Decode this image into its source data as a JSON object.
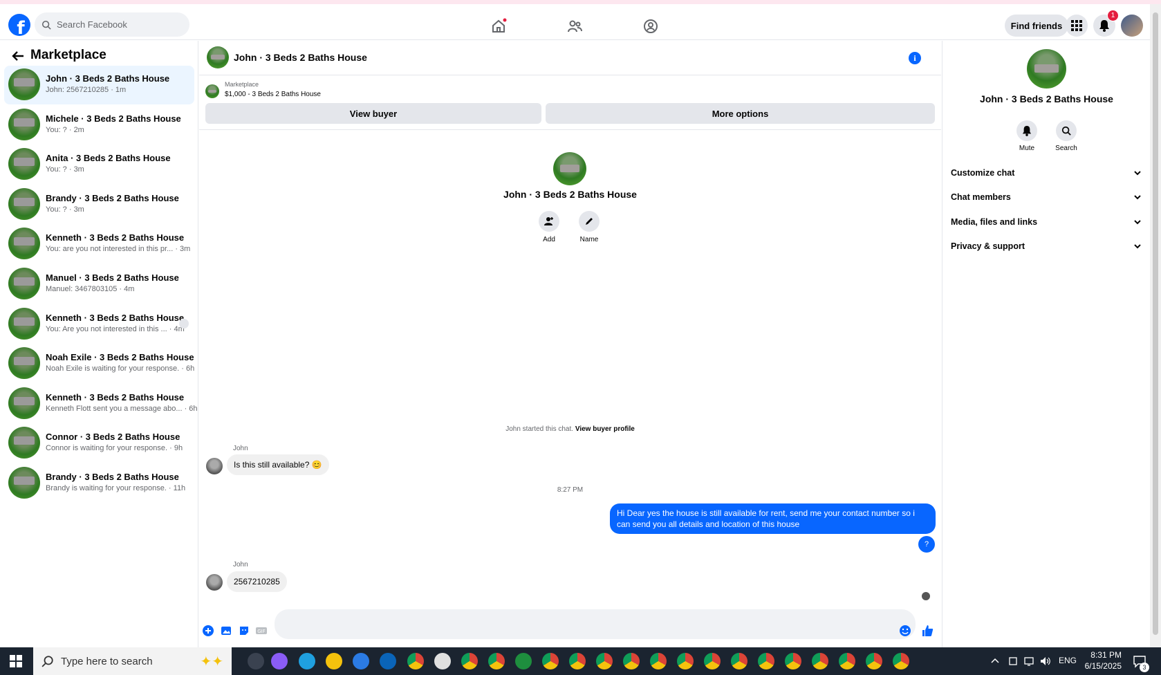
{
  "header": {
    "search_placeholder": "Search Facebook",
    "find_friends": "Find friends",
    "notification_count": "1"
  },
  "sidebar": {
    "title": "Marketplace",
    "conversations": [
      {
        "name": "John · 3 Beds 2 Baths House",
        "preview": "John: 2567210285 · 1m",
        "active": true
      },
      {
        "name": "Michele · 3 Beds 2 Baths House",
        "preview": "You: ? · 2m"
      },
      {
        "name": "Anita · 3 Beds 2 Baths House",
        "preview": "You: ? · 3m"
      },
      {
        "name": "Brandy · 3 Beds 2 Baths House",
        "preview": "You: ? · 3m"
      },
      {
        "name": "Kenneth · 3 Beds 2 Baths House",
        "preview": "You: are you not interested in this pr... · 3m"
      },
      {
        "name": "Manuel · 3 Beds 2 Baths House",
        "preview": "Manuel: 3467803105 · 4m"
      },
      {
        "name": "Kenneth · 3 Beds 2 Baths House",
        "preview": "You: Are you not interested in this ... · 4m"
      },
      {
        "name": "Noah Exile · 3 Beds 2 Baths House",
        "preview": "Noah Exile is waiting for your response. · 6h"
      },
      {
        "name": "Kenneth · 3 Beds 2 Baths House",
        "preview": "Kenneth Flott sent you a message abo... · 6h"
      },
      {
        "name": "Connor · 3 Beds 2 Baths House",
        "preview": "Connor is waiting for your response. · 9h"
      },
      {
        "name": "Brandy · 3 Beds 2 Baths House",
        "preview": "Brandy is waiting for your response. · 11h"
      }
    ]
  },
  "chat": {
    "title": "John · 3 Beds 2 Baths House",
    "marketplace_label": "Marketplace",
    "listing": "$1,000 - 3 Beds 2 Baths House",
    "view_buyer": "View buyer",
    "more_options": "More options",
    "intro_title": "John · 3 Beds 2 Baths House",
    "add_label": "Add",
    "name_label": "Name",
    "started_text": "John started this chat.",
    "view_buyer_profile": "View buyer profile",
    "sender1": "John",
    "msg1": "Is this still available? 😊",
    "time_sep": "8:27 PM",
    "msg_out": "Hi Dear yes the house is still available for rent, send me your contact number so i can send you all details and location of this house",
    "msg_q": "?",
    "sender2": "John",
    "msg2": "2567210285",
    "composer_value": ""
  },
  "right_pane": {
    "title": "John · 3 Beds 2 Baths House",
    "mute": "Mute",
    "search": "Search",
    "rows": [
      "Customize chat",
      "Chat members",
      "Media, files and links",
      "Privacy & support"
    ]
  },
  "taskbar": {
    "search_placeholder": "Type here to search",
    "lang": "ENG",
    "time": "8:31 PM",
    "date": "6/15/2025",
    "notif_count": "3"
  },
  "colors": {
    "brand": "#0866ff",
    "active_row": "#ebf5ff",
    "badge": "#e41e3f"
  }
}
